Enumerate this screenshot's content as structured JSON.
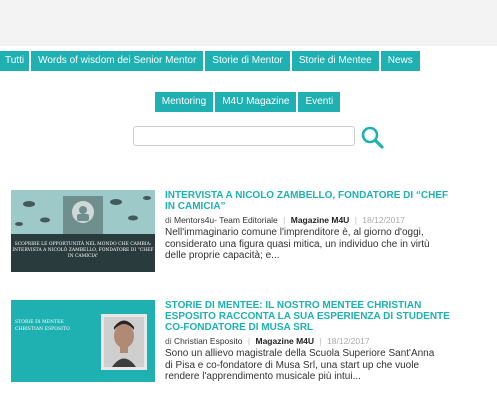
{
  "nav": {
    "row1": [
      "Tutti",
      "Words of wisdom dei Senior Mentor",
      "Storie di Mentor",
      "Storie di Mentee",
      "News"
    ],
    "row2": [
      "Mentoring",
      "M4U Magazine",
      "Eventi"
    ]
  },
  "search": {
    "value": "",
    "placeholder": ""
  },
  "colors": {
    "accent": "#1fb0b1"
  },
  "articles": [
    {
      "title_lines": [
        "INTERVISTA A NICOLÒ ZAMBELLO, FONDATORE DI “CHEF",
        "IN CAMICIA”"
      ],
      "author_prefix": "di",
      "author": "Mentors4u- Team Editoriale",
      "category": "Magazine M4U",
      "date": "18/12/2017",
      "excerpt_lines": [
        "Nell'immaginario comune l'imprenditore è, al giorno d'oggi,",
        "considerato una figura quasi mitica, un individuo che in virtù",
        "delle proprie capacità; e..."
      ],
      "thumb_caption": "Scoprire le opportunità nel mondo che cambia: intervista a Nicolò Zambello, fondatore di “Chef in camicia”"
    },
    {
      "title_lines": [
        "STORIE DI MENTEE: IL NOSTRO MENTEE CHRISTIAN",
        "ESPOSITO RACCONTA LA SUA ESPERIENZA DI STUDENTE",
        "CO-FONDATORE DI MUSA SRL"
      ],
      "author_prefix": "di",
      "author": "Christian  Esposito",
      "category": "Magazine M4U",
      "date": "18/12/2017",
      "excerpt_lines": [
        "Sono un allievo magistrale della Scuola Superiore Sant'Anna",
        "di Pisa e co-fondatore di Musa Srl, una start up che vuole",
        "rendere l'apprendimento musicale più intui..."
      ],
      "thumb_caption": "Storie di Mentee Christian Esposito"
    }
  ]
}
